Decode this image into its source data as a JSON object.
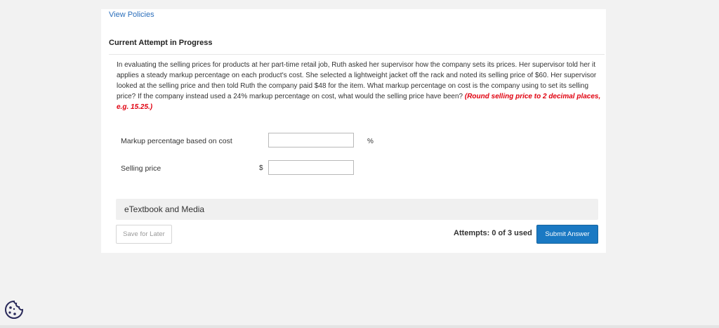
{
  "links": {
    "view_policies": "View Policies"
  },
  "attempt": {
    "title": "Current Attempt in Progress"
  },
  "question": {
    "text": "In evaluating the selling prices for products at her part-time retail job, Ruth asked her supervisor how the company sets its prices. Her supervisor told her it applies a steady markup percentage on each product's cost. She selected a lightweight jacket off the rack and noted its selling price of $60. Her supervisor looked at the selling price and then told Ruth the company paid $48 for the item. What markup percentage on cost is the company using to set its selling price? If the company instead used a 24% markup percentage on cost, what would the selling price have been?",
    "hint": "(Round selling price to 2 decimal places, e.g. 15.25.)"
  },
  "fields": {
    "markup": {
      "label": "Markup percentage based on cost",
      "value": "",
      "unit_suffix": "%"
    },
    "selling_price": {
      "label": "Selling price",
      "value": "",
      "unit_prefix": "$"
    }
  },
  "resources": {
    "etextbook": "eTextbook and Media"
  },
  "actions": {
    "save_label": "Save for Later",
    "attempts_text": "Attempts: 0 of 3 used",
    "submit_label": "Submit Answer"
  },
  "icons": {
    "cookie": "cookie-icon"
  },
  "colors": {
    "link": "#2a6ebb",
    "hint": "#e0000f",
    "submit": "#1a79c3"
  }
}
